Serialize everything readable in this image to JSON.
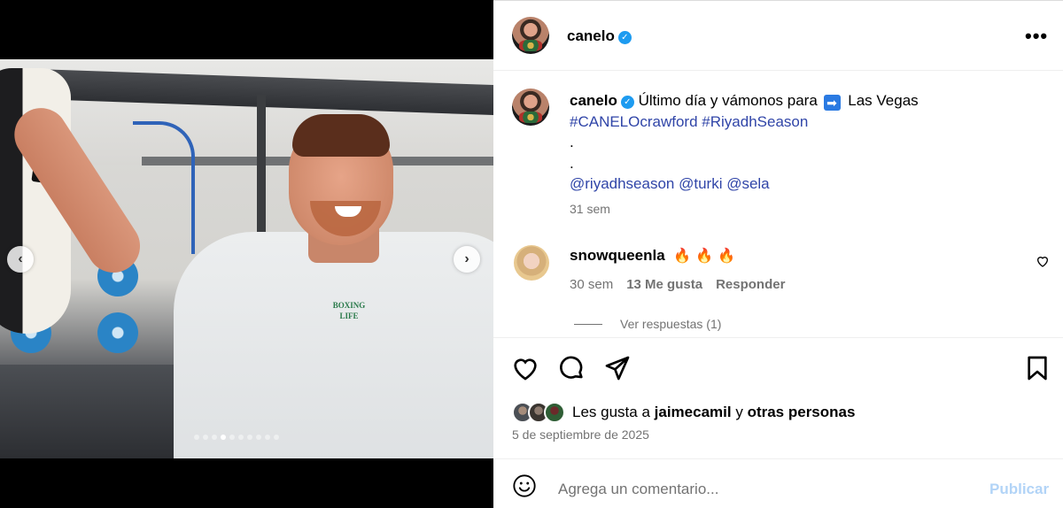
{
  "post": {
    "username": "canelo",
    "verified_icon": "verified-badge-icon",
    "more_icon": "more-options-icon"
  },
  "media": {
    "prev_icon": "chevron-left-icon",
    "next_icon": "chevron-right-icon",
    "carousel": {
      "total": 10,
      "active_index": 4
    },
    "shirt_text": "BOXING LIFE"
  },
  "caption": {
    "username": "canelo",
    "text_before": "Último día y vámonos para",
    "emoji": "➡️",
    "text_after": "Las Vegas",
    "hashtags": "#CANELOcrawford #RiyadhSeason",
    "dot1": ".",
    "dot2": ".",
    "mentions": "@riyadhseason @turki @sela",
    "time": "31 sem"
  },
  "comment": {
    "username": "snowqueenla",
    "emojis": [
      "🔥",
      "🔥",
      "🔥"
    ],
    "time": "30 sem",
    "likes": "13 Me gusta",
    "reply": "Responder",
    "view_replies": "Ver respuestas (1)"
  },
  "actions": {
    "like_icon": "heart-icon",
    "comment_icon": "comment-icon",
    "share_icon": "share-icon",
    "save_icon": "bookmark-icon"
  },
  "likes": {
    "prefix": "Les gusta a",
    "user": "jaimecamil",
    "connector": "y",
    "others": "otras personas"
  },
  "date": "5 de septiembre de 2025",
  "add_comment": {
    "placeholder": "Agrega un comentario...",
    "publish": "Publicar"
  }
}
